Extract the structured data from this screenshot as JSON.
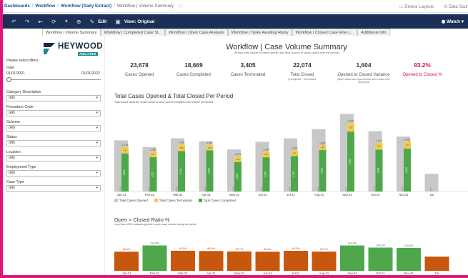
{
  "breadcrumb": {
    "items": [
      "Dashboards",
      "Workflow",
      "Workflow (Daily Extract)"
    ],
    "current": "Workflow | Volume Summary"
  },
  "topright": {
    "device_layouts": "Device Layouts",
    "data_source": "Data Sour"
  },
  "toolbar": {
    "edit": "Edit",
    "view": "View: Original",
    "watch": "Watch"
  },
  "tabs": [
    "Workflow | Volume Summary",
    "Workflow | Completed Case Sl...",
    "Workflow | Open Case Analysis",
    "Workflow | Tasks Awaiting Reply",
    "Workflow | Closed Case Row L...",
    "Additional Info"
  ],
  "logo": {
    "name": "HEYWOOD",
    "sub": "ANALYTICS"
  },
  "filters": {
    "header": "Please select filters",
    "date_label": "Date",
    "date_from": "01/01/2021",
    "date_to": "01/01/2022",
    "dropdowns": [
      {
        "label": "Category Description",
        "value": "(All)"
      },
      {
        "label": "Procedure Code",
        "value": "(All)"
      },
      {
        "label": "Scheme",
        "value": "(All)"
      },
      {
        "label": "Status",
        "value": "(All)"
      },
      {
        "label": "Location",
        "value": "(All)"
      },
      {
        "label": "Employment Type",
        "value": "(All)"
      },
      {
        "label": "Case Type",
        "value": "(All)"
      }
    ]
  },
  "title": "Workflow | Case Volume Summary",
  "subtitle": "(Shows total volume of cases opened and total volume of cases closed over the period)",
  "kpis": [
    {
      "value": "23,678",
      "label": "Cases Opened",
      "note": ""
    },
    {
      "value": "18,669",
      "label": "Cases Completed",
      "note": ""
    },
    {
      "value": "3,405",
      "label": "Cases Terminated",
      "note": ""
    },
    {
      "value": "22,074",
      "label": "Total Closed",
      "note": "(Completed + Terminated)"
    },
    {
      "value": "1,604",
      "label": "Opened to Closed Variance",
      "note": "(More cases were opened than were closed over the period)"
    },
    {
      "value": "93.2%",
      "label": "Opened to Closed %",
      "note": ""
    }
  ],
  "colors": {
    "opened": "#c8c8c8",
    "terminated": "#f2cc4c",
    "completed": "#4ea84b",
    "ratio_low": "#c8570e",
    "ratio_high": "#4ea84b",
    "accent": "#d6134a"
  },
  "chart_data": [
    {
      "type": "bar",
      "title": "Total Cases Opened & Total Closed Per Period",
      "subtitle": "Total closed cases are broken down to show volume completed and volume terminated",
      "categories": [
        "Jan-21",
        "Feb-21",
        "Mar-21",
        "Apr-21",
        "May-21",
        "Jun-21",
        "Jul-21",
        "Aug-21",
        "Sep-21",
        "Oct-21",
        "Nov-21",
        "De"
      ],
      "series": [
        {
          "name": "Total Cases Opened",
          "values": [
            2016,
            1751,
            2098,
            1983,
            1659,
            1958,
            2095,
            2460,
            3062,
            2378,
            2166,
            700
          ]
        },
        {
          "name": "Total Cases Terminated",
          "values": [
            246,
            217,
            258,
            205,
            209,
            220,
            223,
            190,
            328,
            267,
            270,
            0
          ]
        },
        {
          "name": "Total Cases Completed",
          "values": [
            1502,
            1352,
            1594,
            1622,
            1166,
            1349,
            1397,
            1632,
            2362,
            1651,
            1692,
            0
          ]
        }
      ],
      "totals_closed": [
        1748,
        1569,
        1852,
        1827,
        1375,
        1569,
        1620,
        1822,
        2690,
        1918,
        1962,
        null
      ]
    },
    {
      "type": "bar",
      "title": "Open > Closed Ratio %",
      "subtitle": "Less than 100% indicates growth in open case volume during the period",
      "categories": [
        "Jan-21",
        "Feb-21",
        "Mar-21",
        "Apr-21",
        "May-21",
        "Jun-21",
        "Jul-21",
        "Aug-21",
        "Sep-21",
        "Oct-21",
        "Nov-21",
        "De"
      ],
      "values": [
        86.6,
        114.5,
        90.5,
        89.6,
        87.7,
        86.6,
        90.3,
        87.2,
        114.4,
        104.9,
        103.3,
        null
      ]
    }
  ]
}
